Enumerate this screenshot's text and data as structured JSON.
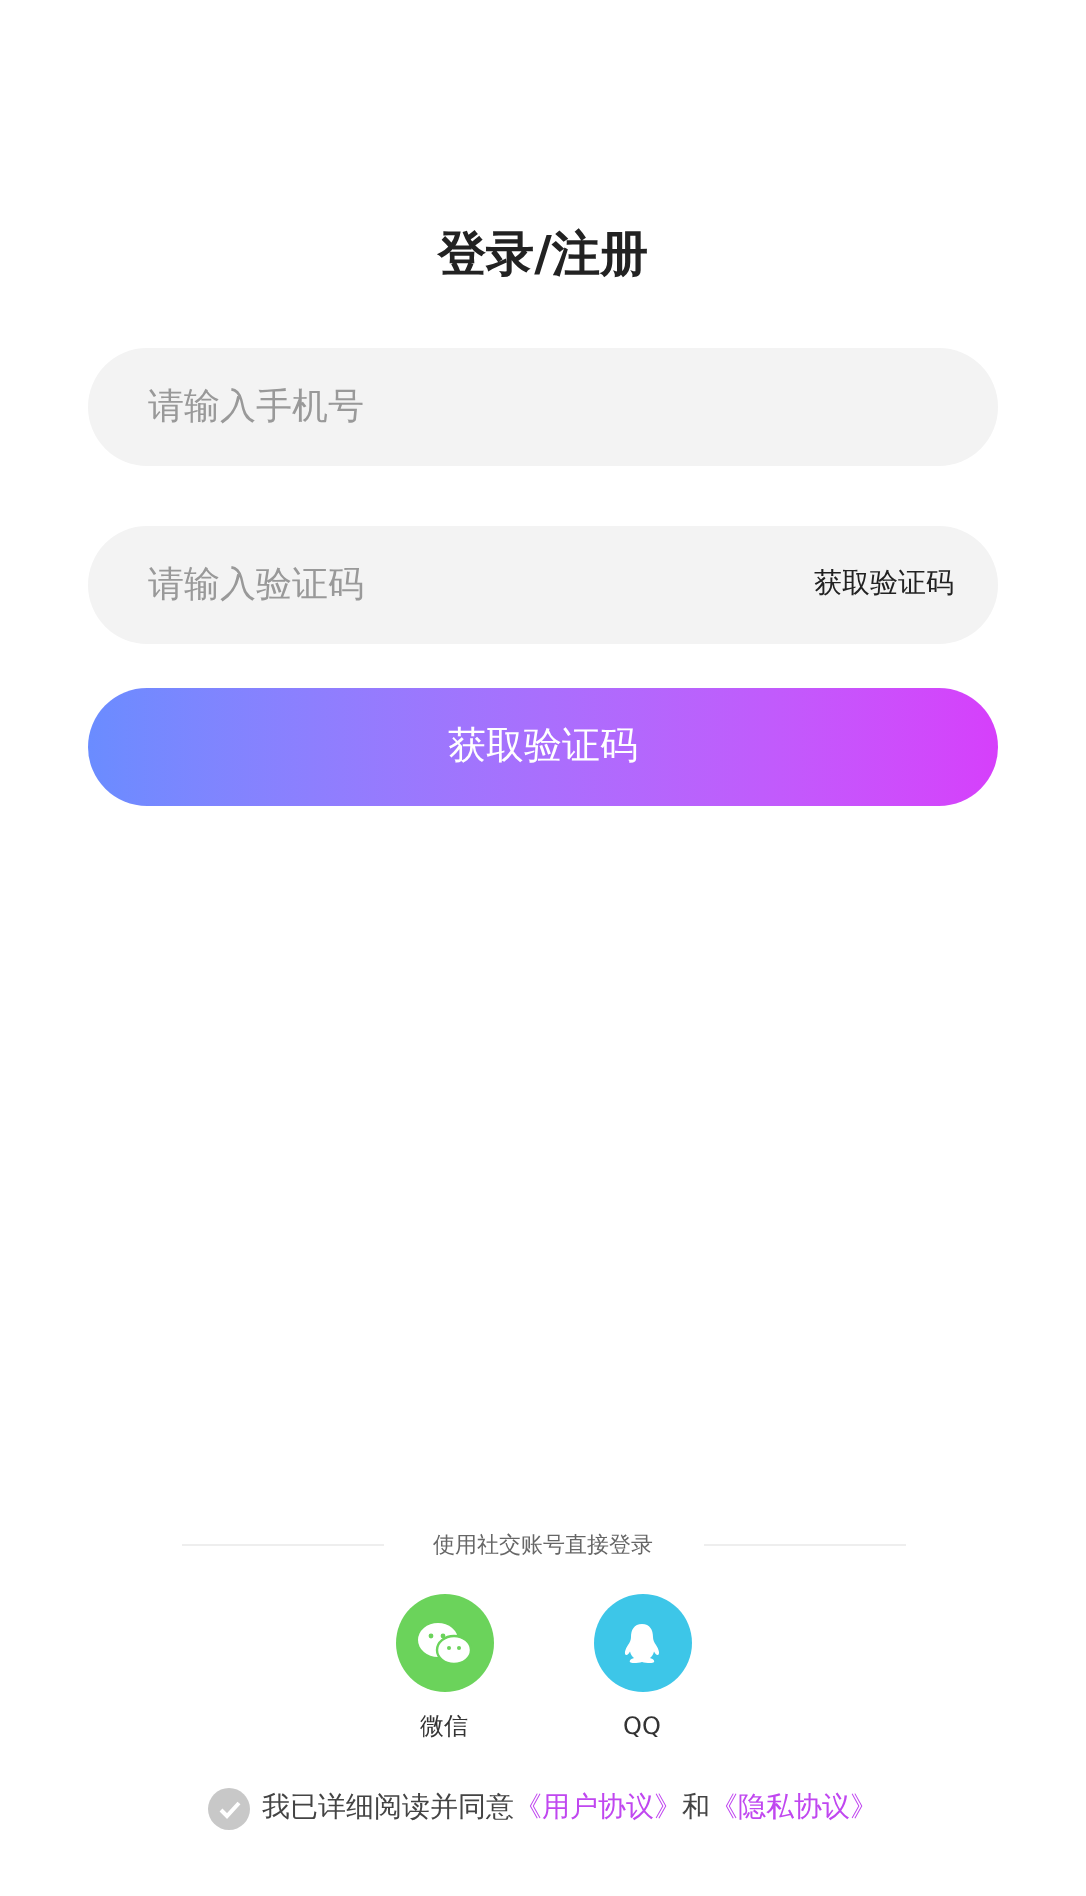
{
  "title": "登录/注册",
  "phone_field": {
    "placeholder": "请输入手机号"
  },
  "code_field": {
    "placeholder": "请输入验证码",
    "action": "获取验证码"
  },
  "submit_button": "获取验证码",
  "social_login": {
    "heading": "使用社交账号直接登录",
    "providers": [
      {
        "kind": "wechat",
        "label": "微信",
        "color": "#6bd35b"
      },
      {
        "kind": "qq",
        "label": "QQ",
        "color": "#3dc6e8"
      }
    ]
  },
  "agreement": {
    "checked": false,
    "text": "我已详细阅读并同意",
    "links": [
      "《用户协议》",
      "《隐私协议》"
    ],
    "joiner": "和"
  }
}
